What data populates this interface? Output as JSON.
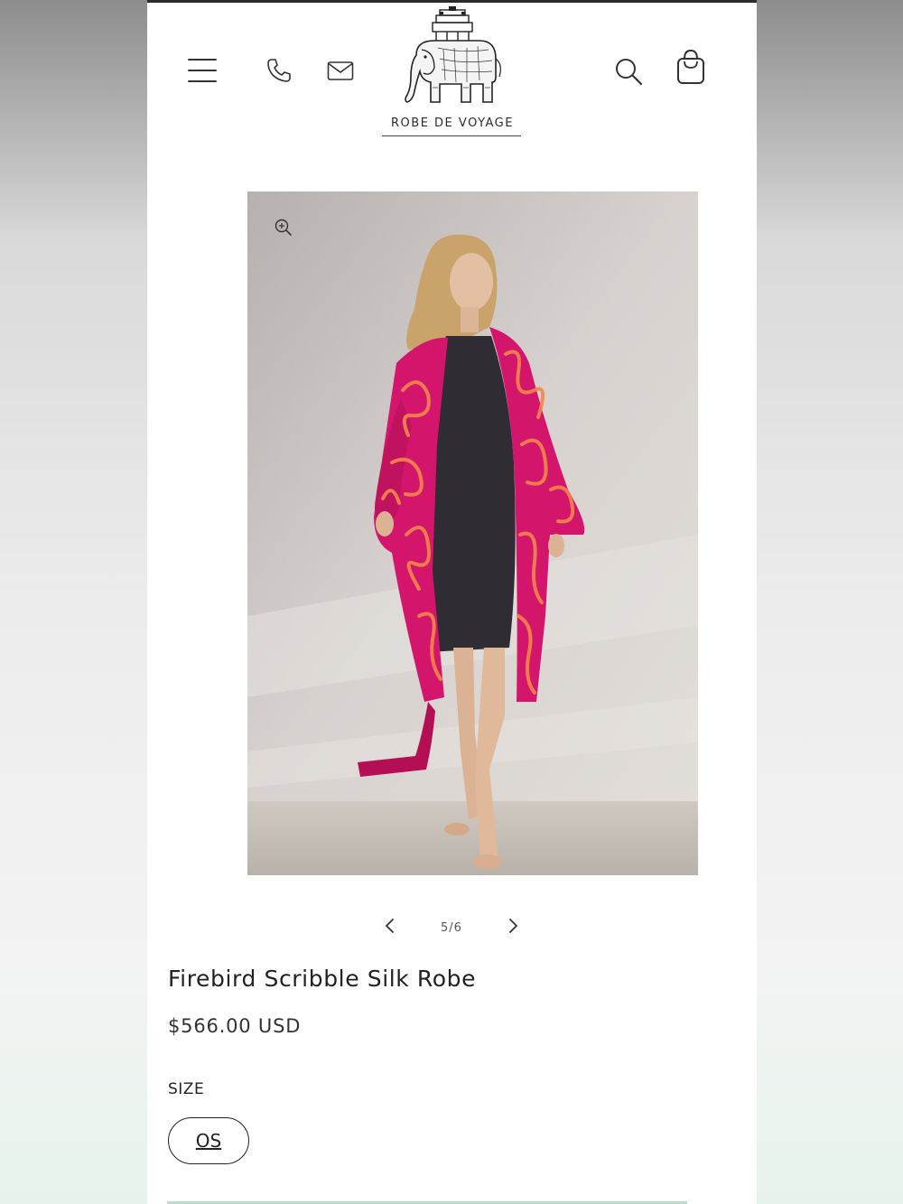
{
  "brand": {
    "name": "ROBE DE VOYAGE"
  },
  "header": {
    "icons": [
      "menu-icon",
      "phone-icon",
      "mail-icon",
      "search-icon",
      "shopping-bag-icon"
    ]
  },
  "gallery": {
    "counter": "5/6",
    "current": 5,
    "total": 6,
    "colors": {
      "robe": "#d3166b",
      "robe_pattern": "#f2874a",
      "dress": "#2f2d33"
    }
  },
  "product": {
    "title": "Firebird Scribble Silk Robe",
    "price": "$566.00 USD"
  },
  "size": {
    "label": "SIZE",
    "options": [
      "OS"
    ],
    "selected": "OS"
  },
  "colors": {
    "accent_bar": "#b8ded0",
    "text": "#222222"
  }
}
